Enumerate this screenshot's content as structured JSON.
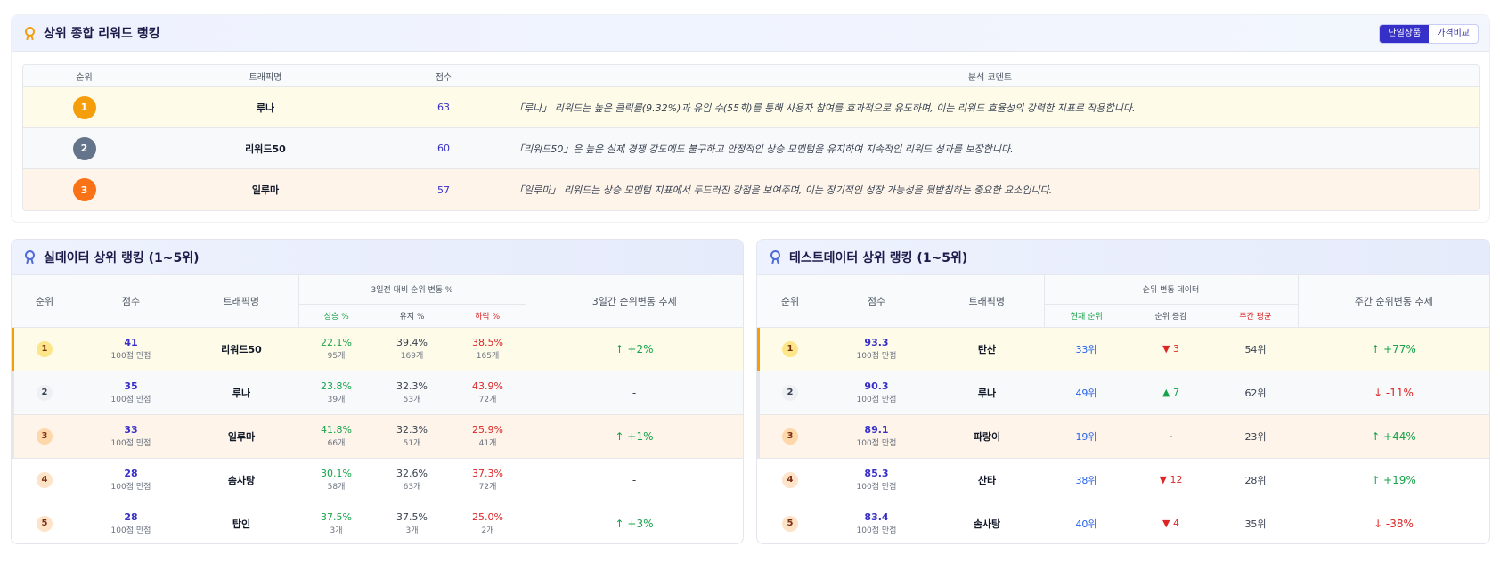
{
  "top": {
    "title": "상위 종합 리워드 랭킹",
    "toggle": [
      "단일상품",
      "가격비교"
    ],
    "headers": [
      "순위",
      "트래픽명",
      "점수",
      "분석 코멘트"
    ],
    "rows": [
      {
        "rank": "1",
        "name": "루나",
        "score": "63",
        "comment": "「루나」 리워드는 높은 클릭률(9.32%)과 유입 수(55회)를 통해 사용자 참여를 효과적으로 유도하며, 이는 리워드 효율성의 강력한 지표로 작용합니다."
      },
      {
        "rank": "2",
        "name": "리워드50",
        "score": "60",
        "comment": "「리워드50」은 높은 실제 경쟁 강도에도 불구하고 안정적인 상승 모멘텀을 유지하여 지속적인 리워드 성과를 보장합니다."
      },
      {
        "rank": "3",
        "name": "일루마",
        "score": "57",
        "comment": "「일루마」 리워드는 상승 모멘텀 지표에서 두드러진 강점을 보여주며, 이는 장기적인 성장 가능성을 뒷받침하는 중요한 요소입니다."
      }
    ],
    "colors": {
      "gold": "#f59e0b",
      "silver": "#64748b",
      "bronze": "#f97316",
      "accent": "#3730c8"
    }
  },
  "real": {
    "title": "실데이터 상위 랭킹 (1~5위)",
    "h_rank": "순위",
    "h_score": "점수",
    "h_name": "트래픽명",
    "h_group": "3일전 대비 순위 변동 %",
    "h_up": "상승 %",
    "h_keep": "유지 %",
    "h_down": "하락 %",
    "h_trend": "3일간 순위변동 추세",
    "rows": [
      {
        "rank": "1",
        "score": "41",
        "sub": "100점 만점",
        "name": "리워드50",
        "up": "22.1%",
        "up_c": "95개",
        "keep": "39.4%",
        "keep_c": "169개",
        "down": "38.5%",
        "down_c": "165개",
        "trend": "↑ +2%"
      },
      {
        "rank": "2",
        "score": "35",
        "sub": "100점 만점",
        "name": "루나",
        "up": "23.8%",
        "up_c": "39개",
        "keep": "32.3%",
        "keep_c": "53개",
        "down": "43.9%",
        "down_c": "72개",
        "trend": "-"
      },
      {
        "rank": "3",
        "score": "33",
        "sub": "100점 만점",
        "name": "일루마",
        "up": "41.8%",
        "up_c": "66개",
        "keep": "32.3%",
        "keep_c": "51개",
        "down": "25.9%",
        "down_c": "41개",
        "trend": "↑ +1%"
      },
      {
        "rank": "4",
        "score": "28",
        "sub": "100점 만점",
        "name": "솜사탕",
        "up": "30.1%",
        "up_c": "58개",
        "keep": "32.6%",
        "keep_c": "63개",
        "down": "37.3%",
        "down_c": "72개",
        "trend": "-"
      },
      {
        "rank": "5",
        "score": "28",
        "sub": "100점 만점",
        "name": "탑인",
        "up": "37.5%",
        "up_c": "3개",
        "keep": "37.5%",
        "keep_c": "3개",
        "down": "25.0%",
        "down_c": "2개",
        "trend": "↑ +3%"
      }
    ]
  },
  "test": {
    "title": "테스트데이터 상위 랭킹 (1~5위)",
    "h_rank": "순위",
    "h_score": "점수",
    "h_name": "트래픽명",
    "h_group": "순위 변동 데이터",
    "h_cur": "현재 순위",
    "h_delta": "순위 증감",
    "h_avg": "주간 평균",
    "h_trend": "주간 순위변동 추세",
    "rows": [
      {
        "rank": "1",
        "score": "93.3",
        "sub": "100점 만점",
        "name": "탄산",
        "cur": "33위",
        "delta": "▼ 3",
        "delta_dir": "down",
        "avg": "54위",
        "trend": "↑ +77%",
        "trend_dir": "up"
      },
      {
        "rank": "2",
        "score": "90.3",
        "sub": "100점 만점",
        "name": "루나",
        "cur": "49위",
        "delta": "▲ 7",
        "delta_dir": "up",
        "avg": "62위",
        "trend": "↓ -11%",
        "trend_dir": "down"
      },
      {
        "rank": "3",
        "score": "89.1",
        "sub": "100점 만점",
        "name": "파랑이",
        "cur": "19위",
        "delta": "-",
        "delta_dir": "none",
        "avg": "23위",
        "trend": "↑ +44%",
        "trend_dir": "up"
      },
      {
        "rank": "4",
        "score": "85.3",
        "sub": "100점 만점",
        "name": "산타",
        "cur": "38위",
        "delta": "▼ 12",
        "delta_dir": "down",
        "avg": "28위",
        "trend": "↑ +19%",
        "trend_dir": "up"
      },
      {
        "rank": "5",
        "score": "83.4",
        "sub": "100점 만점",
        "name": "솜사탕",
        "cur": "40위",
        "delta": "▼ 4",
        "delta_dir": "down",
        "avg": "35위",
        "trend": "↓ -38%",
        "trend_dir": "down"
      }
    ]
  }
}
